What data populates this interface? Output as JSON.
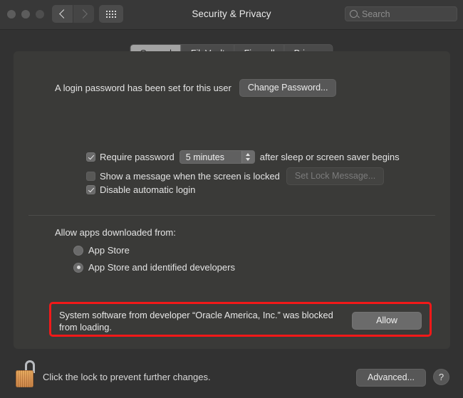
{
  "window": {
    "title": "Security & Privacy",
    "traffic_lights": [
      "close",
      "minimize",
      "zoom"
    ],
    "nav": {
      "back_icon": "chevron-left-icon",
      "forward_icon": "chevron-right-icon",
      "grid_icon": "grid-apps-icon"
    },
    "search": {
      "placeholder": "Search",
      "value": "",
      "icon": "search-icon"
    }
  },
  "tabs": [
    {
      "label": "General",
      "active": true
    },
    {
      "label": "FileVault",
      "active": false
    },
    {
      "label": "Firewall",
      "active": false
    },
    {
      "label": "Privacy",
      "active": false
    }
  ],
  "general": {
    "login_status_text": "A login password has been set for this user",
    "change_password_label": "Change Password...",
    "require_password": {
      "label": "Require password",
      "checked": true,
      "interval_value": "5 minutes",
      "suffix": "after sleep or screen saver begins"
    },
    "show_message": {
      "label": "Show a message when the screen is locked",
      "checked": false,
      "button_label": "Set Lock Message...",
      "button_disabled": true
    },
    "disable_auto_login": {
      "label": "Disable automatic login",
      "checked": true
    }
  },
  "allow_apps": {
    "heading": "Allow apps downloaded from:",
    "options": [
      {
        "label": "App Store",
        "selected": false
      },
      {
        "label": "App Store and identified developers",
        "selected": true
      }
    ]
  },
  "alert": {
    "message": "System software from developer “Oracle America, Inc.” was blocked from loading.",
    "button_label": "Allow",
    "highlight_color": "#f21919"
  },
  "footer": {
    "lock_icon": "unlocked-padlock-icon",
    "lock_text": "Click the lock to prevent further changes.",
    "advanced_label": "Advanced...",
    "help_label": "?"
  },
  "colors": {
    "window_bg": "#323232",
    "panel_bg": "#3a3a38",
    "titlebar_bg": "#383838",
    "active_tab_bg": "#a3a3a3",
    "lock_gold": "#d9904a"
  }
}
